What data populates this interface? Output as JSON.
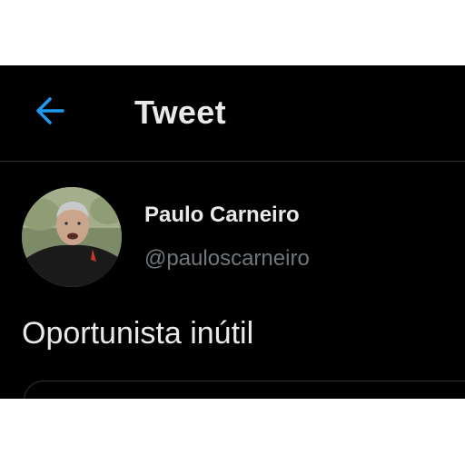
{
  "header": {
    "back_icon": "arrow-left-icon",
    "title": "Tweet"
  },
  "tweet": {
    "author": {
      "display_name": "Paulo Carneiro",
      "handle": "@pauloscarneiro"
    },
    "text": "Oportunista inútil"
  },
  "colors": {
    "background": "#000000",
    "accent": "#1d9bf0",
    "primary_text": "#e7e9ea",
    "secondary_text": "#71767b",
    "divider": "#2f3336"
  }
}
